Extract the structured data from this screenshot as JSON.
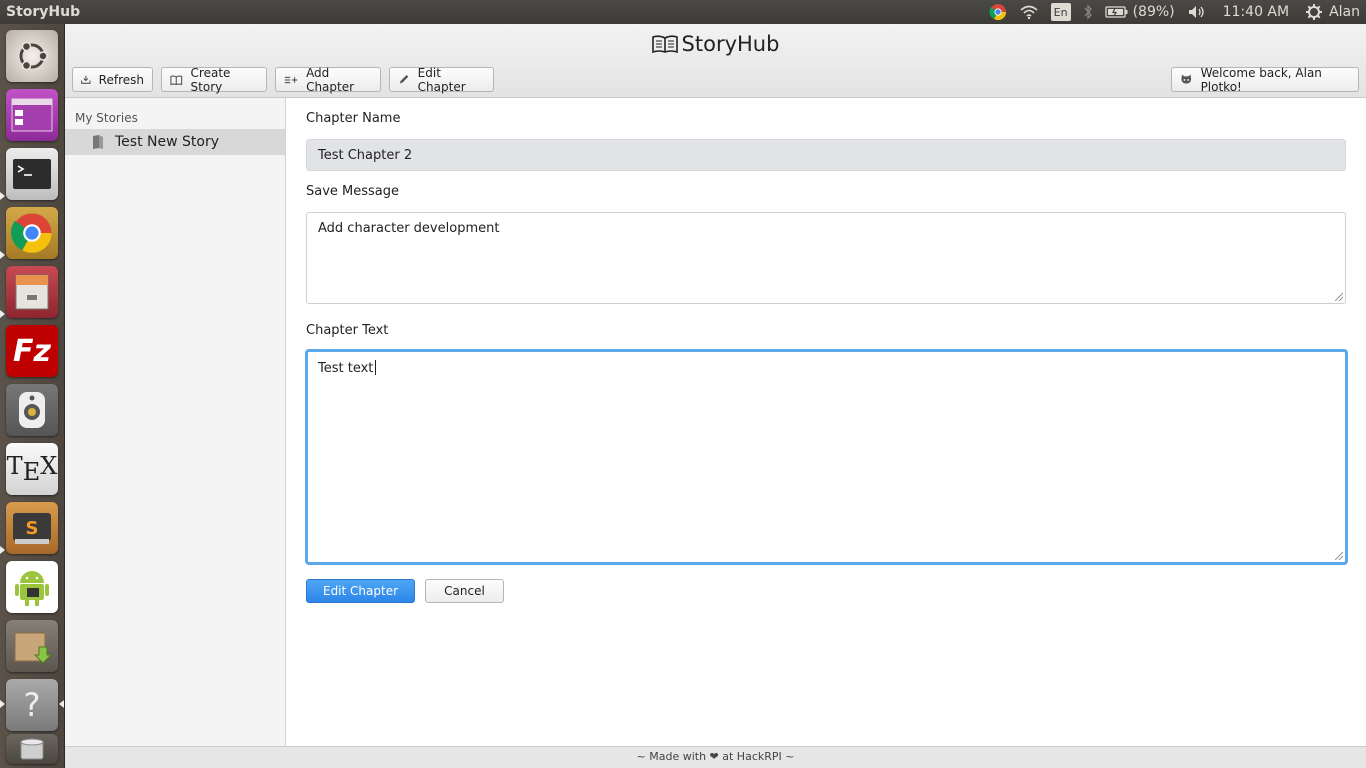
{
  "system": {
    "app_name": "StoryHub",
    "battery": "(89%)",
    "time": "11:40 AM",
    "user": "Alan",
    "keyboard_lang": "En"
  },
  "launcher": {
    "items": [
      "ubuntu-dash",
      "files-manager",
      "terminal",
      "chrome",
      "file-cabinet",
      "filezilla",
      "speaker",
      "tex-editor",
      "sublime-text",
      "android-studio",
      "archive-manager",
      "help",
      "trash"
    ]
  },
  "header": {
    "brand": "StoryHub",
    "toolbar": {
      "refresh": "Refresh",
      "create_story": "Create Story",
      "add_chapter": "Add Chapter",
      "edit_chapter": "Edit Chapter"
    },
    "welcome": "Welcome back, Alan Plotko!"
  },
  "sidebar": {
    "section_title": "My Stories",
    "stories": [
      {
        "label": "Test New Story"
      }
    ]
  },
  "form": {
    "chapter_name_label": "Chapter Name",
    "chapter_name_value": "Test Chapter 2",
    "save_message_label": "Save Message",
    "save_message_value": "Add character development",
    "chapter_text_label": "Chapter Text",
    "chapter_text_value": "Test text",
    "submit_label": "Edit Chapter",
    "cancel_label": "Cancel"
  },
  "footer": {
    "text": "~ Made with ❤ at HackRPI ~"
  },
  "colors": {
    "accent": "#2d86e8",
    "focus_border": "#5ba8ea",
    "topbar": "#3c3b37"
  }
}
